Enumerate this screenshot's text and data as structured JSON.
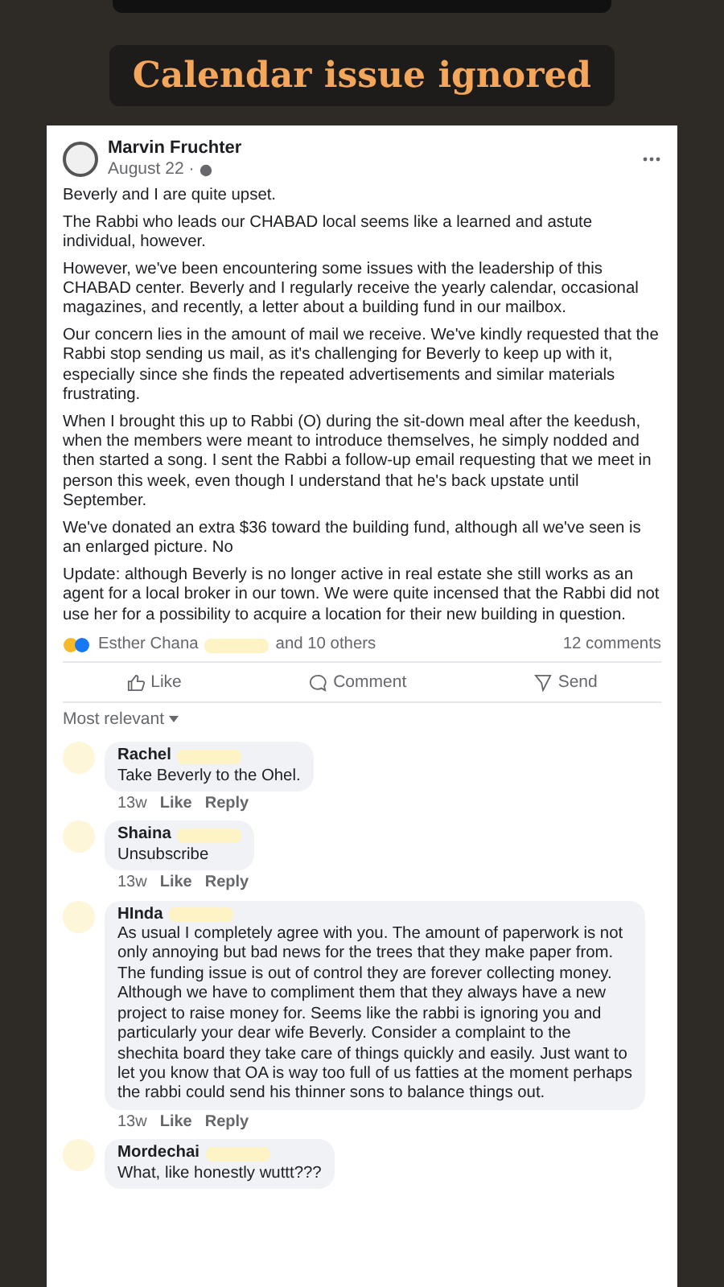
{
  "headline": "Calendar issue ignored",
  "post": {
    "author": "Marvin Fruchter",
    "date": "August 22 ·",
    "paragraphs": [
      "Beverly and I are quite upset.",
      "The Rabbi who leads our CHABAD local seems like a learned and astute individual, however.",
      "However, we've been encountering some issues with the leadership of this CHABAD center. Beverly and I regularly receive the yearly calendar, occasional magazines, and recently, a letter about a building fund in our mailbox.",
      "Our concern lies in the amount of mail we receive. We've kindly requested that the Rabbi stop sending us mail, as it's challenging for Beverly to keep up with it, especially since she finds the repeated advertisements and similar materials frustrating.",
      "When I brought this up to Rabbi (O) during the sit-down meal after the keedush, when the members were meant to introduce themselves, he simply nodded and then started a song. I sent the Rabbi a follow-up email requesting that we meet in person this week, even though I understand that he's back upstate until September.",
      "We've donated an extra $36 toward the building fund, although all we've seen is an enlarged picture. No",
      "Update: although Beverly is no longer active in real estate she still works as an agent for a local broker in our town. We were quite incensed that the Rabbi did not use her for a possibility to acquire a location for their new building in question."
    ],
    "reactors": "Esther Chana",
    "reactors_more": "and 10 others",
    "comments_count": "12 comments",
    "actions": [
      "Like",
      "Comment",
      "Send"
    ]
  },
  "sort": "Most relevant",
  "comments": [
    {
      "name": "Rachel",
      "text": "Take Beverly to the Ohel.",
      "time": "13w",
      "like": "Like",
      "reply": "Reply"
    },
    {
      "name": "Shaina",
      "text": "Unsubscribe",
      "time": "13w",
      "like": "Like",
      "reply": "Reply"
    },
    {
      "name": "HInda",
      "text": "As usual I completely agree with you. The amount of paperwork is not only annoying but bad news for the trees that they make paper from. The funding issue is out of control they are forever collecting money. Although we have to compliment them that they always have a new project to raise money for. Seems like the rabbi is ignoring you and particularly your dear wife Beverly. Consider a complaint to the shechita board they take care of things quickly and easily. Just want to let you know that OA is way too full of us fatties at the moment perhaps the rabbi could send his thinner sons to balance things out.",
      "time": "13w",
      "like": "Like",
      "reply": "Reply"
    },
    {
      "name": "Mordechai",
      "text": "What, like honestly wuttt???"
    }
  ]
}
